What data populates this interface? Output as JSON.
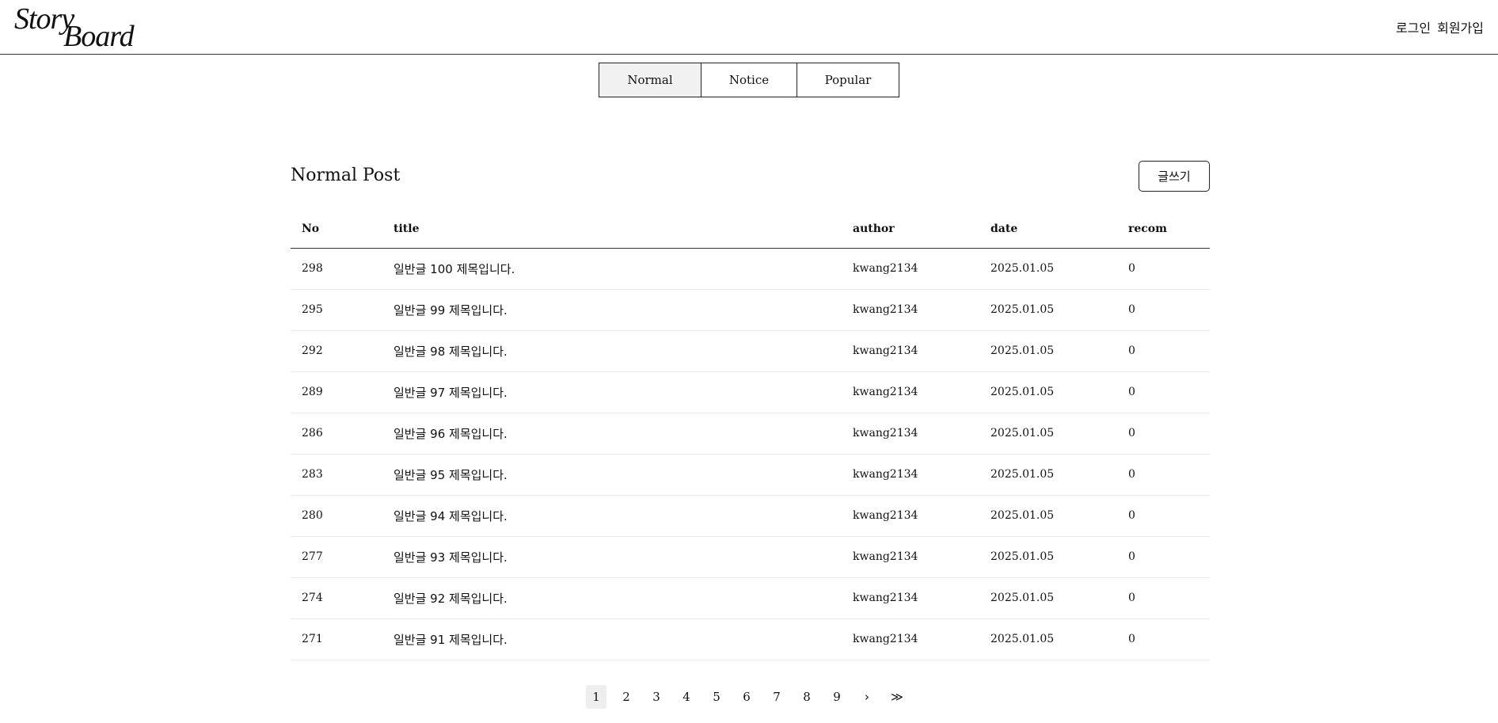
{
  "header": {
    "logo_line1": "Story",
    "logo_line2": "Board",
    "login": "로그인",
    "signup": "회원가입"
  },
  "tabs": [
    {
      "label": "Normal",
      "active": true
    },
    {
      "label": "Notice",
      "active": false
    },
    {
      "label": "Popular",
      "active": false
    }
  ],
  "board": {
    "title": "Normal Post",
    "write_label": "글쓰기",
    "columns": [
      "No",
      "title",
      "author",
      "date",
      "recom"
    ],
    "rows": [
      {
        "no": "298",
        "title": "일반글 100 제목입니다.",
        "author": "kwang2134",
        "date": "2025.01.05",
        "recom": "0"
      },
      {
        "no": "295",
        "title": "일반글 99 제목입니다.",
        "author": "kwang2134",
        "date": "2025.01.05",
        "recom": "0"
      },
      {
        "no": "292",
        "title": "일반글 98 제목입니다.",
        "author": "kwang2134",
        "date": "2025.01.05",
        "recom": "0"
      },
      {
        "no": "289",
        "title": "일반글 97 제목입니다.",
        "author": "kwang2134",
        "date": "2025.01.05",
        "recom": "0"
      },
      {
        "no": "286",
        "title": "일반글 96 제목입니다.",
        "author": "kwang2134",
        "date": "2025.01.05",
        "recom": "0"
      },
      {
        "no": "283",
        "title": "일반글 95 제목입니다.",
        "author": "kwang2134",
        "date": "2025.01.05",
        "recom": "0"
      },
      {
        "no": "280",
        "title": "일반글 94 제목입니다.",
        "author": "kwang2134",
        "date": "2025.01.05",
        "recom": "0"
      },
      {
        "no": "277",
        "title": "일반글 93 제목입니다.",
        "author": "kwang2134",
        "date": "2025.01.05",
        "recom": "0"
      },
      {
        "no": "274",
        "title": "일반글 92 제목입니다.",
        "author": "kwang2134",
        "date": "2025.01.05",
        "recom": "0"
      },
      {
        "no": "271",
        "title": "일반글 91 제목입니다.",
        "author": "kwang2134",
        "date": "2025.01.05",
        "recom": "0"
      }
    ]
  },
  "pagination": {
    "pages": [
      "1",
      "2",
      "3",
      "4",
      "5",
      "6",
      "7",
      "8",
      "9"
    ],
    "active": "1",
    "next": "›",
    "last": "≫"
  }
}
